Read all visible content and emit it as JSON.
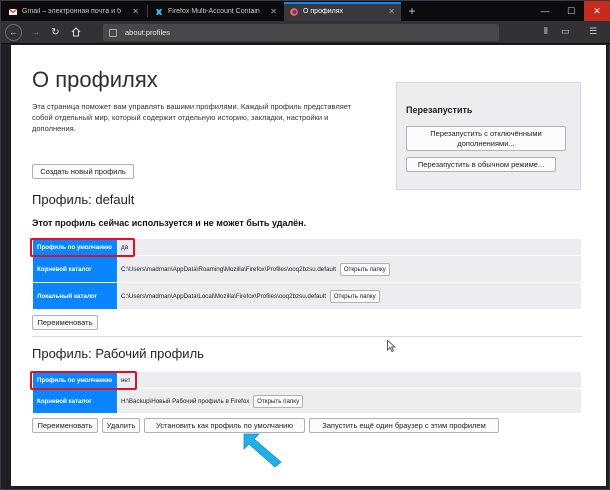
{
  "tabs": [
    {
      "label": "Gmail – электронная почта и б",
      "icon": "gmail-icon"
    },
    {
      "label": "Firefox Multi-Account Contain",
      "icon": "extension-icon"
    },
    {
      "label": "О профилях",
      "icon": "firefox-icon"
    }
  ],
  "window_controls": {
    "minimize": "—",
    "maximize": "☐",
    "close": "✕"
  },
  "nav": {
    "back": "←",
    "forward": "→",
    "reload": "↻",
    "url": "about:profiles"
  },
  "page": {
    "title": "О профилях",
    "intro": "Эта страница поможет вам управлять вашими профилями. Каждый профиль представляет собой отдельный мир, который содержит отдельную историю, закладки, настройки и дополнения.",
    "create_button": "Создать новый профиль",
    "restart": {
      "title": "Перезапустить",
      "with_addons_disabled": "Перезапустить с отключёнными дополнениями...",
      "normal": "Перезапустить в обычном режиме..."
    },
    "profiles": [
      {
        "heading": "Профиль: default",
        "in_use_notice": "Этот профиль сейчас используется и не может быть удалён.",
        "rows": [
          {
            "key": "Профиль по умолчанию",
            "value": "да"
          },
          {
            "key": "Корневой каталог",
            "value": "C:\\Users\\madman\\AppData\\Roaming\\Mozilla\\Firefox\\Profiles\\ooq2bzsu.default",
            "button": "Открыть папку"
          },
          {
            "key": "Локальный каталог",
            "value": "C:\\Users\\madman\\AppData\\Local\\Mozilla\\Firefox\\Profiles\\ooq2bzsu.default",
            "button": "Открыть папку"
          }
        ],
        "buttons": [
          "Переименовать"
        ]
      },
      {
        "heading": "Профиль: Рабочий профиль",
        "rows": [
          {
            "key": "Профиль по умолчанию",
            "value": "нет"
          },
          {
            "key": "Корневой каталог",
            "value": "H:\\Backup\\Новый Рабочий профиль в Firefox",
            "button": "Открыть папку"
          }
        ],
        "buttons": [
          "Переименовать",
          "Удалить",
          "Установить как профиль по умолчанию",
          "Запустить ещё один браузер с этим профилем"
        ]
      }
    ]
  },
  "colors": {
    "accent": "#0a84ff",
    "highlight": "#e0102b",
    "callout": "#1fb1e6"
  }
}
